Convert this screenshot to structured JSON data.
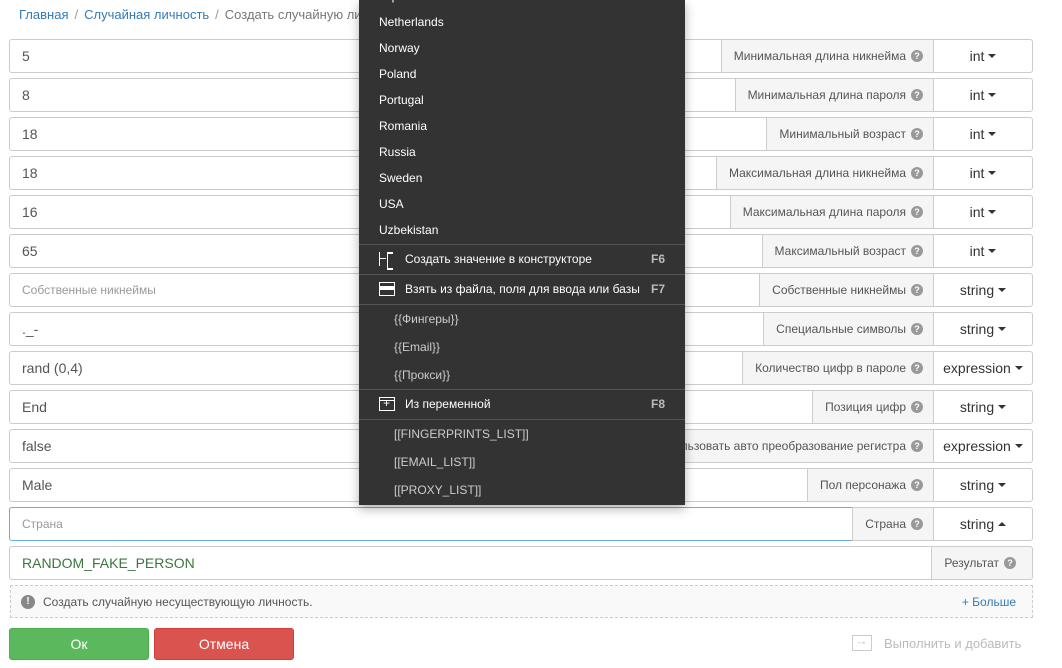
{
  "breadcrumb": {
    "home": "Главная",
    "section": "Случайная личность",
    "current": "Создать случайную личнос"
  },
  "rows": [
    {
      "value": "5",
      "label": "Минимальная длина никнейма",
      "type": "int"
    },
    {
      "value": "8",
      "label": "Минимальная длина пароля",
      "type": "int"
    },
    {
      "value": "18",
      "label": "Минимальный возраст",
      "type": "int"
    },
    {
      "value": "18",
      "label": "Максимальная длина никнейма",
      "type": "int"
    },
    {
      "value": "16",
      "label": "Максимальная длина пароля",
      "type": "int"
    },
    {
      "value": "65",
      "label": "Максимальный возраст",
      "type": "int"
    },
    {
      "value": "",
      "placeholder": "Собственные никнеймы",
      "label": "Собственные никнеймы",
      "type": "string"
    },
    {
      "value": "._-",
      "label": "Специальные символы",
      "type": "string"
    },
    {
      "value": "rand (0,4)",
      "label": "Количество цифр в пароле",
      "type": "expression"
    },
    {
      "value": "End",
      "label": "Позиция цифр",
      "type": "string"
    },
    {
      "value": "false",
      "label": "льзовать авто преобразование регистра",
      "type": "expression"
    },
    {
      "value": "Male",
      "label": "Пол персонажа",
      "type": "string"
    },
    {
      "value": "",
      "placeholder": "Страна",
      "label": "Страна",
      "type": "string"
    }
  ],
  "result": {
    "value": "RANDOM_FAKE_PERSON",
    "label": "Результат"
  },
  "info": {
    "text": "Создать случайную несуществующую личность.",
    "more": "+ Больше"
  },
  "buttons": {
    "ok": "Ок",
    "cancel": "Отмена",
    "run_add": "Выполнить и добавить"
  },
  "dropdown": {
    "countries": [
      "Japan",
      "Netherlands",
      "Norway",
      "Poland",
      "Portugal",
      "Romania",
      "Russia",
      "Sweden",
      "USA",
      "Uzbekistan"
    ],
    "constructor": {
      "label": "Создать значение в конструкторе",
      "key": "F6"
    },
    "from_file": {
      "label": "Взять из файла, поля для ввода или базы",
      "key": "F7"
    },
    "resources": [
      "{{Фингеры}}",
      "{{Email}}",
      "{{Прокси}}"
    ],
    "from_var": {
      "label": "Из переменной",
      "key": "F8"
    },
    "variables": [
      "[[FINGERPRINTS_LIST]]",
      "[[EMAIL_LIST]]",
      "[[PROXY_LIST]]"
    ]
  }
}
